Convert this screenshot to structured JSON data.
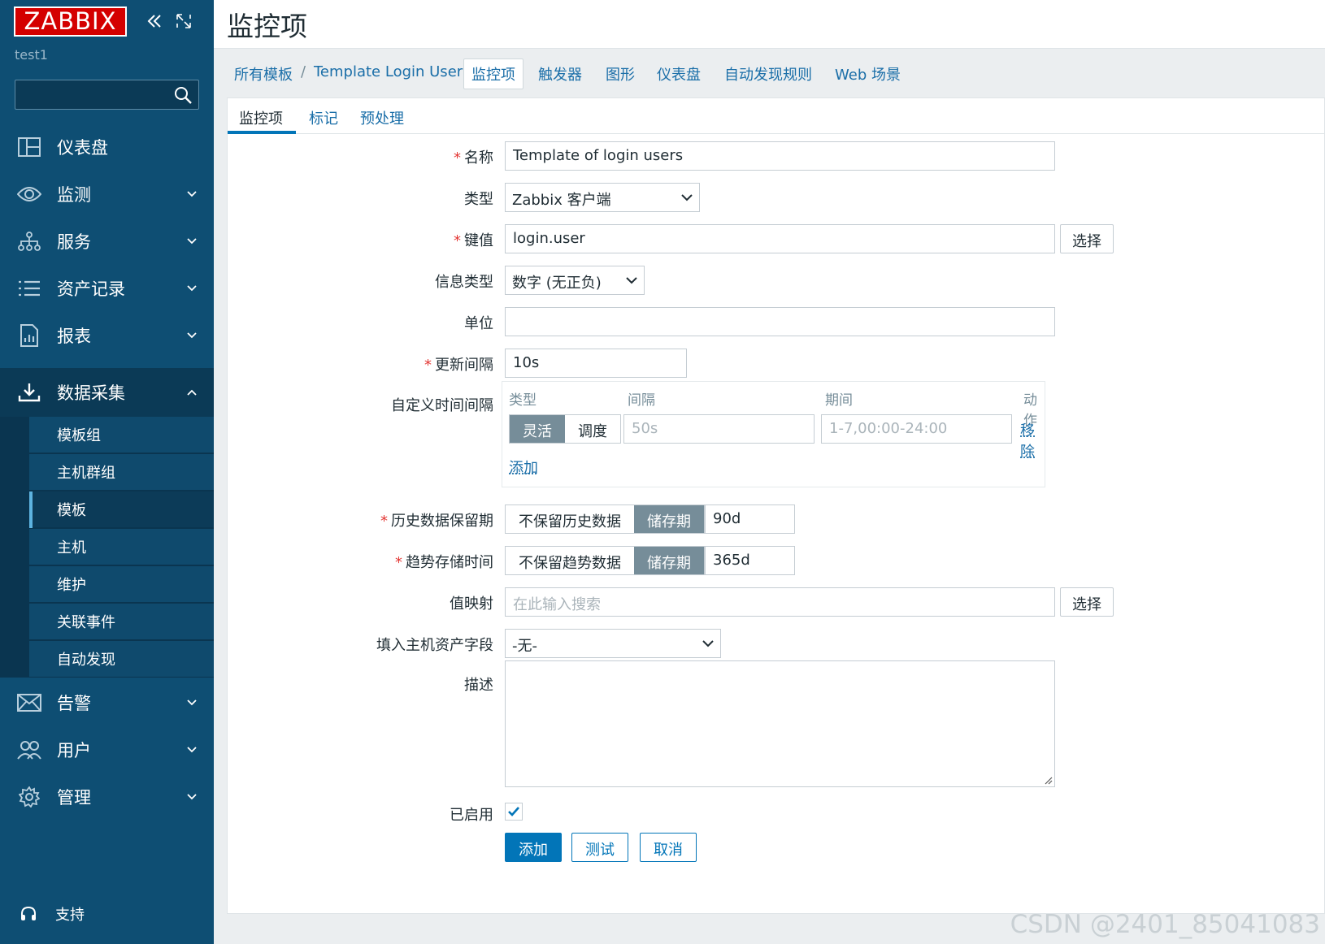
{
  "app": {
    "logo": "ZABBIX",
    "server_name": "test1"
  },
  "sidebar": {
    "items": [
      {
        "label": "仪表盘",
        "icon": "dashboard-icon"
      },
      {
        "label": "监测",
        "icon": "eye-icon"
      },
      {
        "label": "服务",
        "icon": "services-icon"
      },
      {
        "label": "资产记录",
        "icon": "list-icon"
      },
      {
        "label": "报表",
        "icon": "report-icon"
      },
      {
        "label": "数据采集",
        "icon": "download-icon"
      },
      {
        "label": "告警",
        "icon": "mail-icon"
      },
      {
        "label": "用户",
        "icon": "users-icon"
      },
      {
        "label": "管理",
        "icon": "gear-icon"
      }
    ],
    "subitems": [
      "模板组",
      "主机群组",
      "模板",
      "主机",
      "维护",
      "关联事件",
      "自动发现"
    ],
    "support": "支持"
  },
  "header": {
    "title": "监控项"
  },
  "nav": {
    "breadcrumb_all": "所有模板",
    "breadcrumb_sep": "/",
    "breadcrumb_template": "Template Login User",
    "links": [
      "监控项",
      "触发器",
      "图形",
      "仪表盘",
      "自动发现规则",
      "Web 场景"
    ]
  },
  "tabs": [
    "监控项",
    "标记",
    "预处理"
  ],
  "form": {
    "name_label": "名称",
    "name_value": "Template of login users",
    "type_label": "类型",
    "type_value": "Zabbix 客户端",
    "key_label": "键值",
    "key_value": "login.user",
    "select_label": "选择",
    "info_type_label": "信息类型",
    "info_type_value": "数字 (无正负)",
    "units_label": "单位",
    "units_value": "",
    "interval_label": "更新间隔",
    "interval_value": "10s",
    "custom_label": "自定义时间间隔",
    "custom_headers": [
      "类型",
      "间隔",
      "期间",
      "动作"
    ],
    "custom_type_options": [
      "灵活",
      "调度"
    ],
    "custom_interval_placeholder": "50s",
    "custom_period_placeholder": "1-7,00:00-24:00",
    "custom_remove": "移除",
    "custom_add": "添加",
    "history_label": "历史数据保留期",
    "history_options": [
      "不保留历史数据",
      "储存期"
    ],
    "history_value": "90d",
    "trends_label": "趋势存储时间",
    "trends_options": [
      "不保留趋势数据",
      "储存期"
    ],
    "trends_value": "365d",
    "valuemap_label": "值映射",
    "valuemap_placeholder": "在此输入搜索",
    "inventory_label": "填入主机资产字段",
    "inventory_value": "-无-",
    "description_label": "描述",
    "enabled_label": "已启用",
    "enabled": true,
    "buttons": {
      "add": "添加",
      "test": "测试",
      "cancel": "取消"
    }
  },
  "watermark": "CSDN @2401_85041083",
  "colors": {
    "sidebar": "#0e4e73",
    "accent": "#0275b8",
    "logo": "#d40000",
    "required": "#e33734"
  }
}
